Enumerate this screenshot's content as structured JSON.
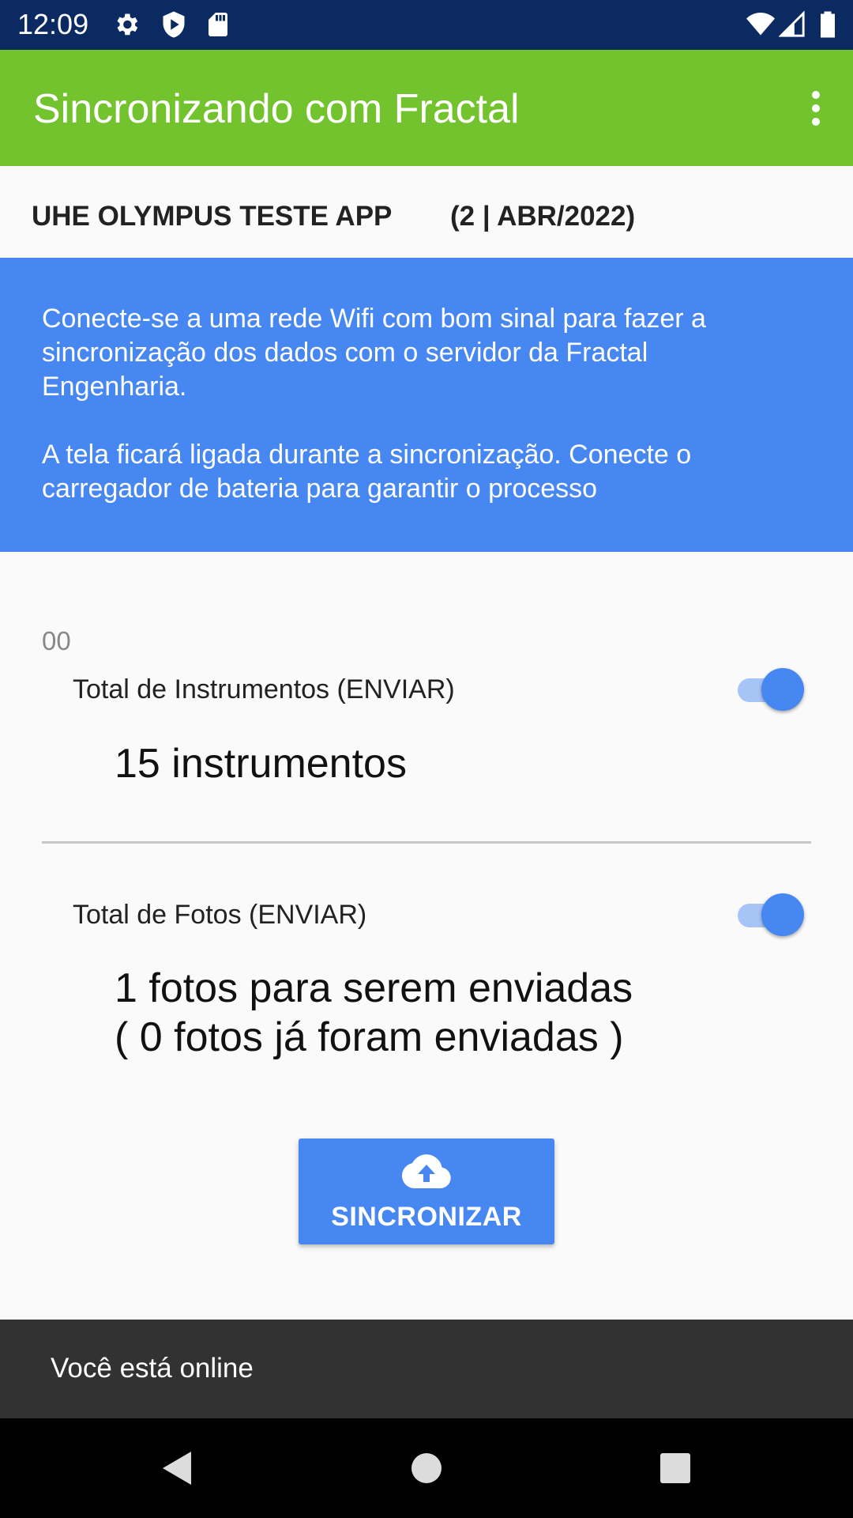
{
  "status_bar": {
    "time": "12:09",
    "icons": [
      "settings-icon",
      "shield-icon",
      "sd-card-icon",
      "wifi-icon",
      "signal-icon",
      "battery-icon"
    ]
  },
  "app_bar": {
    "title": "Sincronizando com Fractal",
    "menu_icon": "more-vert-icon"
  },
  "project": {
    "name": "UHE OLYMPUS TESTE APP",
    "period": "(2 | ABR/2022)"
  },
  "info": {
    "paragraph1": "Conecte-se a uma rede Wifi com bom sinal para fazer a sincronização dos dados com o servidor da Fractal Engenharia.",
    "paragraph2": "A tela ficará ligada durante a sincronização. Conecte o carregador de bateria para garantir o processo"
  },
  "section_code": "00",
  "instruments": {
    "label": "Total de Instrumentos (ENVIAR)",
    "value": "15 instrumentos",
    "toggle_on": true
  },
  "photos": {
    "label": "Total de Fotos (ENVIAR)",
    "value_line1": "1 fotos para serem enviadas",
    "value_line2": "( 0 fotos já foram enviadas )",
    "toggle_on": true
  },
  "sync_button": {
    "label": "SINCRONIZAR",
    "icon": "cloud-upload-icon"
  },
  "snackbar": {
    "text": "Você está online"
  },
  "nav_bar": {
    "items": [
      "back-icon",
      "home-icon",
      "recents-icon"
    ]
  },
  "colors": {
    "status_bar": "#0b2a62",
    "app_bar": "#73c32e",
    "accent_blue": "#4787f2",
    "snackbar": "#323232"
  }
}
